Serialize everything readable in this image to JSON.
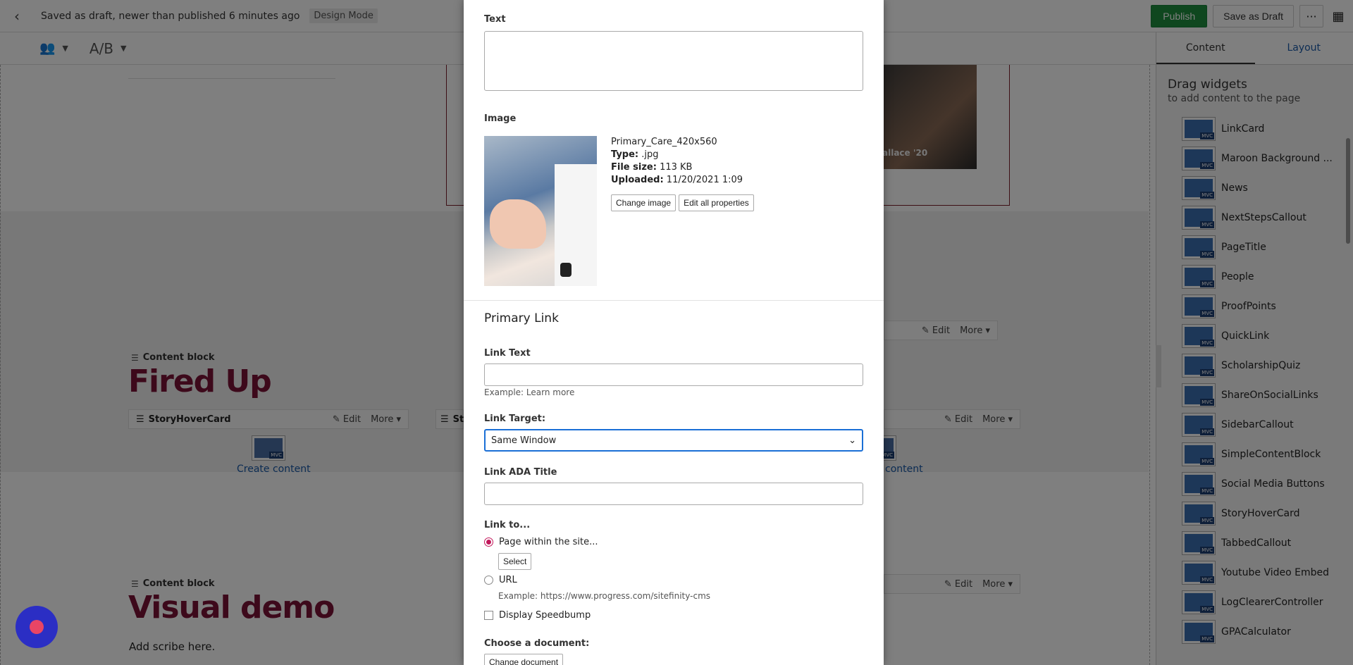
{
  "topbar": {
    "status": "Saved as draft, newer than published 6 minutes ago",
    "mode_badge": "Design Mode",
    "publish": "Publish",
    "save_draft": "Save as Draft",
    "more": "···",
    "grid": "▦"
  },
  "toolbar2": {
    "ab": "A/B"
  },
  "canvas": {
    "hero_caption": "allace '20",
    "block1": {
      "label": "Content block",
      "title": "Fired Up",
      "widget1": "StoryHoverCard",
      "widget2_stub": "Sto",
      "edit": "Edit",
      "more": "More",
      "create": "Create content",
      "create2": "content"
    },
    "block2": {
      "label": "Content block",
      "title": "Visual demo",
      "text": "Add scribe here.",
      "edit": "Edit",
      "more": "More"
    }
  },
  "panel": {
    "tabs": [
      "Content",
      "Layout"
    ],
    "heading": "Drag widgets",
    "subheading": "to add content to the page",
    "widgets": [
      "LinkCard",
      "Maroon Background ...",
      "News",
      "NextStepsCallout",
      "PageTitle",
      "People",
      "ProofPoints",
      "QuickLink",
      "ScholarshipQuiz",
      "ShareOnSocialLinks",
      "SidebarCallout",
      "SimpleContentBlock",
      "Social Media Buttons",
      "StoryHoverCard",
      "TabbedCallout",
      "Youtube Video Embed",
      "LogClearerController",
      "GPACalculator"
    ],
    "icon_tag": "MVC"
  },
  "modal": {
    "text_label": "Text",
    "image_label": "Image",
    "image_name": "Primary_Care_420x560",
    "type_label": "Type:",
    "type_value": ".jpg",
    "size_label": "File size:",
    "size_value": "113 KB",
    "uploaded_label": "Uploaded:",
    "uploaded_value": "11/20/2021 1:09",
    "change_image": "Change image",
    "edit_props": "Edit all properties",
    "primary_link": "Primary Link",
    "link_text_label": "Link Text",
    "link_text_hint": "Example: Learn more",
    "link_target_label": "Link Target:",
    "link_target_value": "Same Window",
    "ada_label": "Link ADA Title",
    "link_to_label": "Link to...",
    "radio_page": "Page within the site...",
    "select_btn": "Select",
    "radio_url": "URL",
    "url_hint": "Example: https://www.progress.com/sitefinity-cms",
    "speedbump": "Display Speedbump",
    "doc_label": "Choose a document:",
    "change_doc": "Change document"
  }
}
